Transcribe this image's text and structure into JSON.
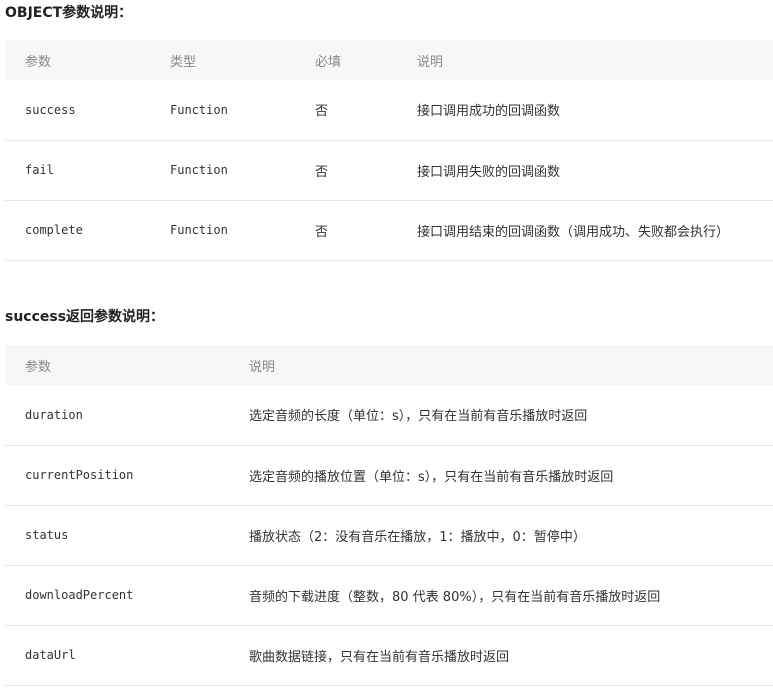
{
  "sections": [
    {
      "title": "OBJECT参数说明：",
      "columns": [
        "参数",
        "类型",
        "必填",
        "说明"
      ],
      "rows": [
        {
          "param": "success",
          "type": "Function",
          "required": "否",
          "desc": "接口调用成功的回调函数"
        },
        {
          "param": "fail",
          "type": "Function",
          "required": "否",
          "desc": "接口调用失败的回调函数"
        },
        {
          "param": "complete",
          "type": "Function",
          "required": "否",
          "desc": "接口调用结束的回调函数（调用成功、失败都会执行）"
        }
      ]
    },
    {
      "title": "success返回参数说明：",
      "columns": [
        "参数",
        "说明"
      ],
      "rows": [
        {
          "param": "duration",
          "desc": "选定音频的长度（单位：s），只有在当前有音乐播放时返回"
        },
        {
          "param": "currentPosition",
          "desc": "选定音频的播放位置（单位：s），只有在当前有音乐播放时返回"
        },
        {
          "param": "status",
          "desc": "播放状态（2：没有音乐在播放，1：播放中，0：暂停中）"
        },
        {
          "param": "downloadPercent",
          "desc": "音频的下载进度（整数，80 代表 80%），只有在当前有音乐播放时返回"
        },
        {
          "param": "dataUrl",
          "desc": "歌曲数据链接，只有在当前有音乐播放时返回"
        }
      ]
    }
  ]
}
